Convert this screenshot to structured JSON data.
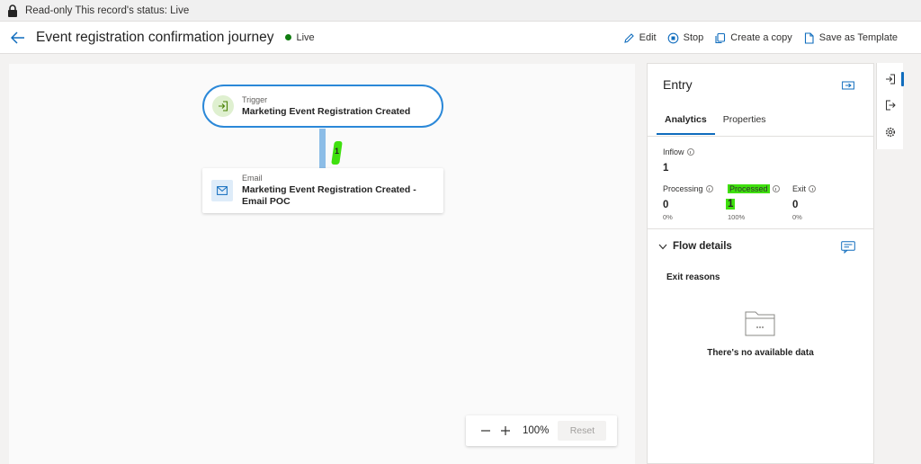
{
  "banner": {
    "text": "Read-only This record's status: Live"
  },
  "header": {
    "title": "Event registration confirmation journey",
    "status": "Live",
    "actions": {
      "edit": "Edit",
      "stop": "Stop",
      "copy": "Create a copy",
      "template": "Save as Template"
    }
  },
  "canvas": {
    "trigger": {
      "type": "Trigger",
      "name": "Marketing Event Registration Created"
    },
    "connector_count": "1",
    "email": {
      "type": "Email",
      "name_line1": "Marketing Event Registration Created -",
      "name_line2": "Email POC"
    },
    "zoom": {
      "level": "100%",
      "reset_label": "Reset"
    }
  },
  "panel": {
    "title": "Entry",
    "tabs": [
      {
        "label": "Analytics",
        "active": true
      },
      {
        "label": "Properties",
        "active": false
      }
    ],
    "inflow": {
      "label": "Inflow",
      "value": "1"
    },
    "processing": {
      "label": "Processing",
      "value": "0",
      "pct": "0%"
    },
    "processed": {
      "label": "Processed",
      "value": "1",
      "pct": "100%"
    },
    "exit": {
      "label": "Exit",
      "value": "0",
      "pct": "0%"
    },
    "flow_details": "Flow details",
    "exit_reasons": "Exit reasons",
    "empty": "There's no available data"
  },
  "colors": {
    "accent": "#0f6cbd",
    "live": "#107c10",
    "highlight": "#3fe00e",
    "connector": "#8cbde7"
  }
}
